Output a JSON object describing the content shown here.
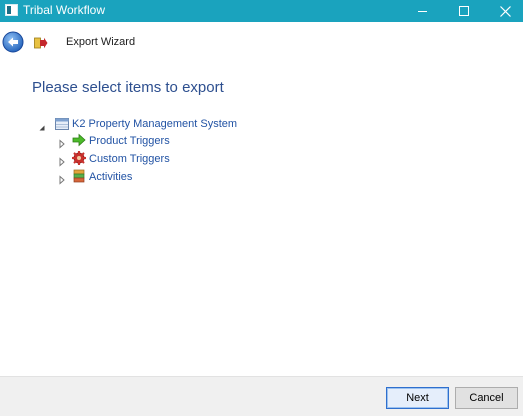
{
  "window": {
    "title": "Tribal Workflow",
    "icon": "app-window-icon",
    "controls": {
      "minimize": "minimize-icon",
      "maximize": "maximize-icon",
      "close": "close-icon"
    },
    "accent_color": "#1aa3be"
  },
  "header": {
    "back_icon": "back-arrow-icon",
    "wizard_icon": "export-wizard-icon",
    "title": "Export Wizard"
  },
  "main": {
    "heading": "Please select items to export",
    "heading_color": "#2d4f8f",
    "tree": {
      "root": {
        "label": "K2 Property Management System",
        "icon": "system-table-icon",
        "expanded": true,
        "children": [
          {
            "label": "Product Triggers",
            "icon": "green-arrow-icon",
            "expanded": false
          },
          {
            "label": "Custom Triggers",
            "icon": "red-gear-icon",
            "expanded": false
          },
          {
            "label": "Activities",
            "icon": "activity-stack-icon",
            "expanded": false
          }
        ]
      }
    }
  },
  "footer": {
    "next_label": "Next",
    "cancel_label": "Cancel"
  }
}
